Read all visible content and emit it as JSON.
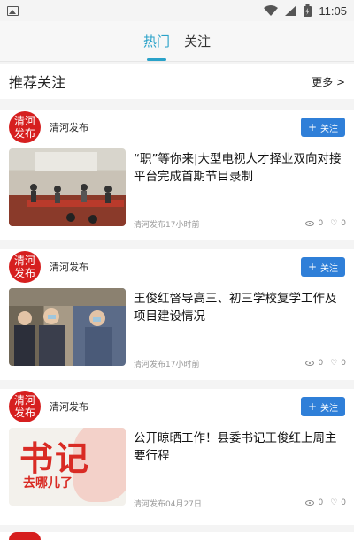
{
  "status_bar": {
    "time": "11:05"
  },
  "tabs": [
    {
      "label": "热门",
      "active": true
    },
    {
      "label": "关注",
      "active": false
    }
  ],
  "recommend": {
    "title": "推荐关注",
    "more_label": "更多 >"
  },
  "cards": [
    {
      "author": "清河发布",
      "logo_text": [
        "清河",
        "发布"
      ],
      "follow_label": "关注",
      "headline": "“职”等你来|大型电视人才择业双向对接平台完成首期节目录制",
      "source_time": "清河发布17小时前",
      "views": "0",
      "likes": "0"
    },
    {
      "author": "清河发布",
      "logo_text": [
        "清河",
        "发布"
      ],
      "follow_label": "关注",
      "headline": "王俊红督导高三、初三学校复学工作及项目建设情况",
      "source_time": "清河发布17小时前",
      "views": "0",
      "likes": "0"
    },
    {
      "author": "清河发布",
      "logo_text": [
        "清河",
        "发布"
      ],
      "follow_label": "关注",
      "headline": "公开晾晒工作！县委书记王俊红上周主要行程",
      "source_time": "清河发布04月27日",
      "views": "0",
      "likes": "0",
      "thumb_text": {
        "big": "书记",
        "sub": "去哪儿了"
      }
    }
  ],
  "colors": {
    "accent": "#2aa2c9",
    "follow_button": "#2f7fd8",
    "logo_red": "#d61f1f"
  },
  "icons": [
    "image-icon",
    "wifi-icon",
    "signal-icon",
    "battery-icon",
    "plus-icon",
    "eye-icon",
    "heart-icon"
  ]
}
